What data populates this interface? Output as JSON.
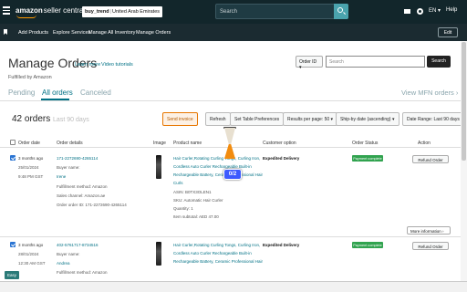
{
  "topbar": {
    "logo_brand": "amazon",
    "logo_product": "seller central",
    "store_name": "buy_trend",
    "store_region": "United Arab Emirates",
    "search_placeholder": "Search",
    "language": "EN",
    "help": "Help",
    "accent_color": "#ff9900",
    "icons": [
      "hamburger-icon",
      "search-icon",
      "mail-icon",
      "gear-icon",
      "chevron-down-icon"
    ]
  },
  "nav": {
    "items": [
      "Add Products",
      "Explore Services",
      "Manage All Inventory",
      "Manage Orders"
    ],
    "edit_label": "Edit"
  },
  "page": {
    "title": "Manage Orders",
    "learn_more": "Learn more",
    "video_tutorials": "Video tutorials",
    "fulfilled_by": "Fulfilled by Amazon",
    "search_field_select": "Order ID",
    "search_placeholder": "Search",
    "search_button": "Search"
  },
  "tabs": {
    "items": [
      "Pending",
      "All orders",
      "Canceled"
    ],
    "active": "All orders",
    "view_mfn": "View MFN orders ›"
  },
  "toolbar": {
    "orders_count": "42 orders",
    "orders_period": "Last 90 days",
    "send_invoice": "Send invoice",
    "refresh": "Refresh",
    "set_table_prefs": "Set Table Preferences",
    "results_per_page": "Results per page: 50",
    "sort_by": "Ship-by date (ascending)",
    "date_range": "Date Range: Last 90 days"
  },
  "table": {
    "headers": [
      "Order date",
      "Order details",
      "Image",
      "Product name",
      "Customer option",
      "Order Status",
      "Action"
    ],
    "rows": [
      {
        "age": "3 months ago",
        "date": "25/01/2024",
        "time": "9:48 PM GST",
        "order_id": "171-2272690-4265114",
        "buyer_label": "Buyer name:",
        "buyer_name": "Irene",
        "fulfillment": "Fulfillment method: Amazon",
        "sales_channel": "Sales channel: Amazon.ae",
        "order_id_detail": "Order order ID: 171-2272690-4265114",
        "product": [
          "Hair Curler,Rotating Curling Tongs, Curling Iron,",
          "Cordless Auto Curler Rechargeable Built-in",
          "Rechargeable Battery, Ceramic Professional Hair",
          "Curls"
        ],
        "asin": "ASIN: B0TX3OLEN1",
        "sku": "SKU: Automatic Hair Curler",
        "quantity": "Quantity: 1",
        "item_subtotal": "Item subtotal: AED 47.00",
        "customer_option": "Expedited Delivery",
        "status": "Payment complete",
        "action": "Refund Order",
        "more_info": "More information ›"
      },
      {
        "age": "3 months ago",
        "date": "28/01/2024",
        "time": "12:30 AM GST",
        "order_id": "402-5761717-8734516",
        "buyer_label": "Buyer name:",
        "buyer_name": "Andrea",
        "fulfillment": "Fulfillment method: Amazon",
        "product": [
          "Hair Curler,Rotating Curling Tongs, Curling Iron,",
          "Cordless Auto Curler Rechargeable Built-in",
          "Rechargeable Battery, Ceramic Professional Hair"
        ],
        "customer_option": "Expedited Delivery",
        "status": "Payment complete",
        "action": "Refund Order"
      }
    ]
  },
  "overlay": {
    "progress_label": "0/2"
  },
  "bottom": {
    "tag": "Easy"
  }
}
